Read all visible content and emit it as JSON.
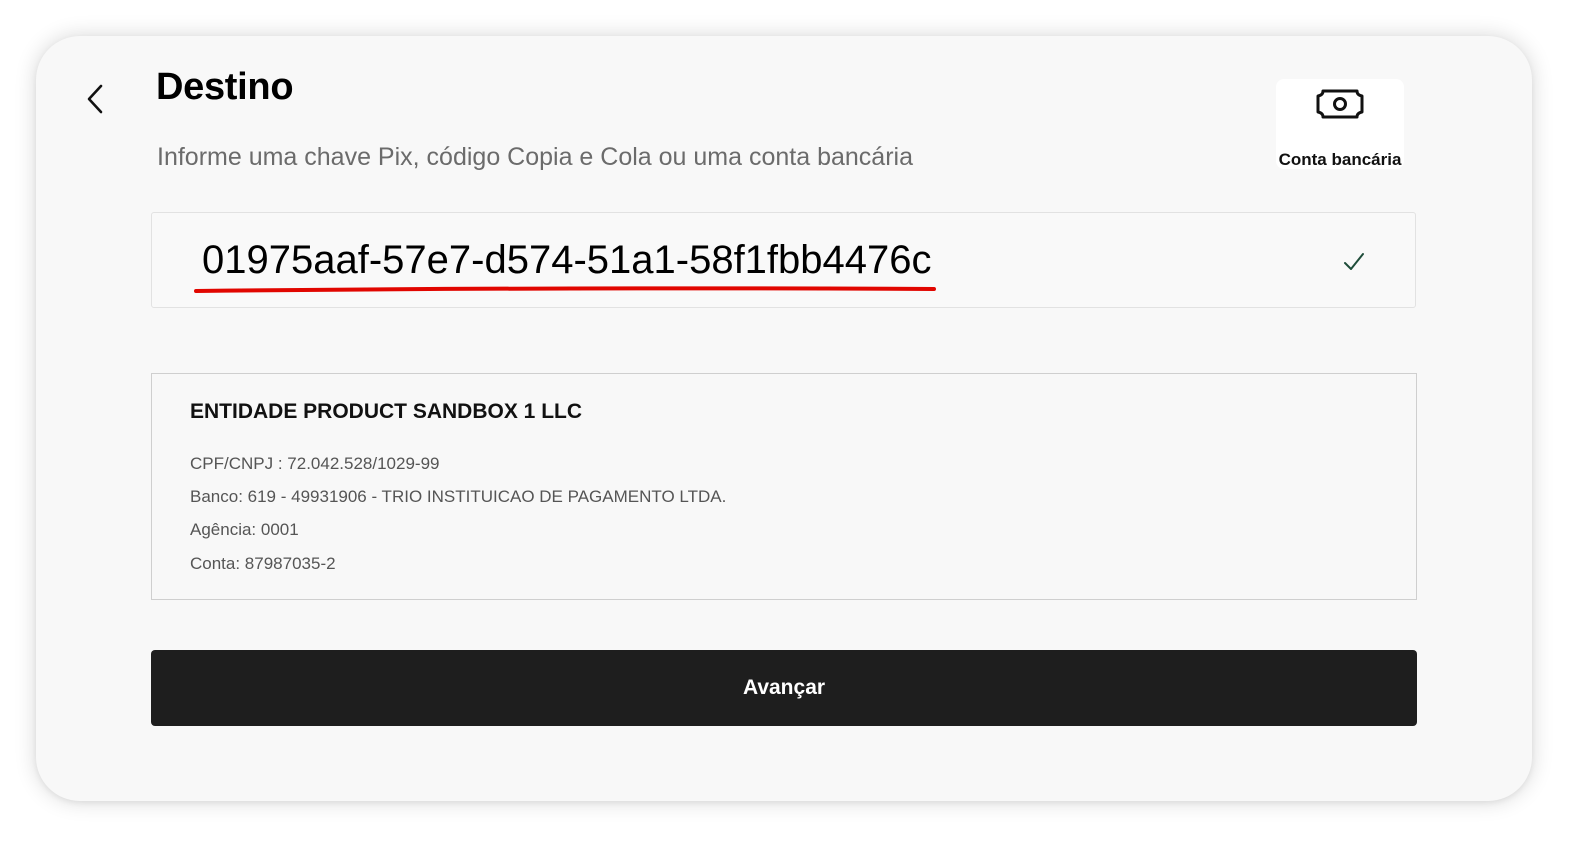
{
  "header": {
    "title": "Destino",
    "subtitle": "Informe uma chave Pix, código Copia e Cola ou uma conta bancária",
    "back_icon": "chevron-left-icon"
  },
  "bank_option": {
    "icon": "money-bill-icon",
    "label": "Conta bancária"
  },
  "key_field": {
    "value": "01975aaf-57e7-d574-51a1-58f1fbb4476c",
    "status_icon": "check-icon",
    "highlight_color": "#e10600",
    "check_color": "#1f4d3a"
  },
  "recipient": {
    "name": "ENTIDADE PRODUCT SANDBOX 1 LLC",
    "document": "CPF/CNPJ : 72.042.528/1029-99",
    "bank": "Banco: 619 - 49931906 - TRIO INSTITUICAO DE PAGAMENTO LTDA.",
    "agency": "Agência: 0001",
    "account": "Conta: 87987035-2"
  },
  "actions": {
    "submit_label": "Avançar"
  }
}
